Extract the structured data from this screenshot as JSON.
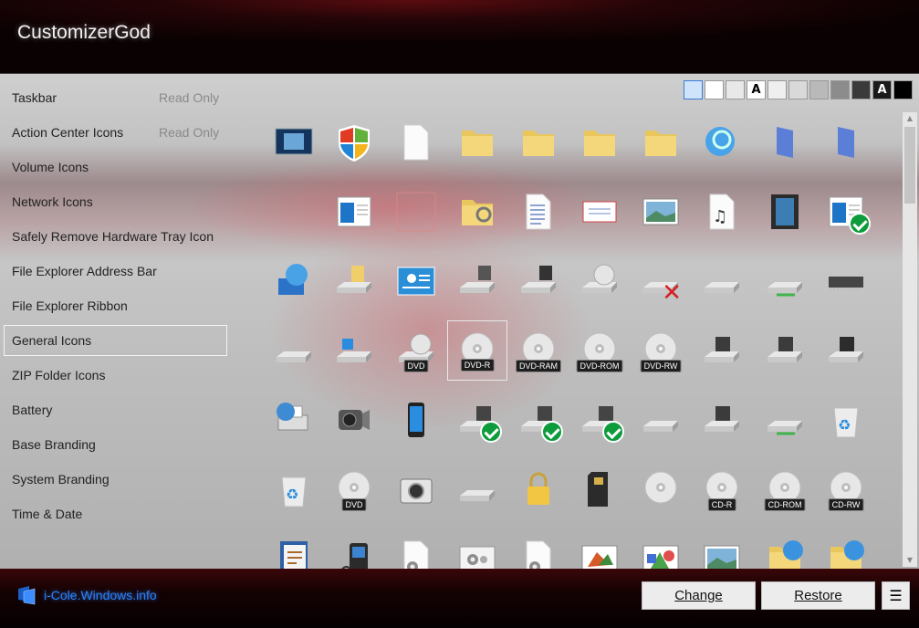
{
  "app": {
    "title": "CustomizerGod"
  },
  "sidebar": {
    "items": [
      {
        "label": "Taskbar",
        "badge": "Read Only"
      },
      {
        "label": "Action Center Icons",
        "badge": "Read Only"
      },
      {
        "label": "Volume Icons"
      },
      {
        "label": "Network Icons"
      },
      {
        "label": "Safely Remove Hardware Tray Icon"
      },
      {
        "label": "File Explorer Address Bar"
      },
      {
        "label": "File Explorer Ribbon"
      },
      {
        "label": "General Icons",
        "selected": true
      },
      {
        "label": "ZIP Folder Icons"
      },
      {
        "label": "Battery"
      },
      {
        "label": "Base Branding"
      },
      {
        "label": "System Branding"
      },
      {
        "label": "Time & Date"
      }
    ]
  },
  "swatches": [
    {
      "color": "#cfe3fa",
      "text": ""
    },
    {
      "color": "#ffffff",
      "text": ""
    },
    {
      "color": "#e8e8e8",
      "text": ""
    },
    {
      "color": "#ffffff",
      "text": "A",
      "text_color": "#000000"
    },
    {
      "color": "#efefef",
      "text": ""
    },
    {
      "color": "#d9d9d9",
      "text": ""
    },
    {
      "color": "#b9b9b9",
      "text": ""
    },
    {
      "color": "#8c8c8c",
      "text": ""
    },
    {
      "color": "#3a3a3a",
      "text": ""
    },
    {
      "color": "#1a1a1a",
      "text": "A",
      "text_color": "#ffffff"
    },
    {
      "color": "#000000",
      "text": ""
    }
  ],
  "icon_grid": [
    [
      "monitor-windows-icon",
      "shield-icon",
      "blank-document-icon",
      "folder-icon",
      "folder-icon",
      "folder-icon",
      "folder-narrow-icon",
      "",
      "globe-search-icon",
      "library-icon",
      "library-narrow-icon"
    ],
    [
      "",
      "window-app-icon",
      "blank-square-icon",
      "folder-search-icon",
      "text-document-icon",
      "envelope-document-icon",
      "image-document-icon",
      "music-document-icon",
      "video-document-icon",
      "window-check-icon"
    ],
    [
      "network-globe-icon",
      "drive-folder-icon",
      "control-panel-icon",
      "floppy-drive-icon",
      "floppy-drive-dark-icon",
      "cd-drive-icon",
      "drive-error-icon",
      "drive-icon",
      "network-drive-icon",
      "memory-chip-icon"
    ],
    [
      "drive-flat-icon",
      "windows-drive-icon",
      "dvd-drive-icon",
      "dvd-r-disc-icon",
      "dvd-ram-disc-icon",
      "dvd-rom-disc-icon",
      "dvd-rw-disc-icon",
      "removable-drive-icon",
      "card-drive-icon",
      "usb-drive-icon"
    ],
    [
      "printer-network-icon",
      "camcorder-icon",
      "phone-icon",
      "drive-check-icon",
      "drive-check-icon",
      "drive-check-icon",
      "drive-icon",
      "removable-drive-icon",
      "network-drive-icon",
      "recycle-bin-full-icon"
    ],
    [
      "recycle-bin-empty-icon",
      "dvd-disc-icon",
      "camera-icon",
      "drive-shortcut-icon",
      "padlock-icon",
      "sd-card-icon",
      "disc-icon",
      "cd-r-disc-icon",
      "cd-rom-disc-icon",
      "cd-rw-disc-icon"
    ],
    [
      "contacts-icon",
      "media-player-icon",
      "settings-document-icon",
      "settings-window-icon",
      "settings-file-icon",
      "paint-picture-icon",
      "shapes-picture-icon",
      "landscape-picture-icon",
      "network-folder-icon",
      "network-folder-icon"
    ]
  ],
  "disc_labels": {
    "dvd-drive-icon": "DVD",
    "dvd-r-disc-icon": "DVD-R",
    "dvd-ram-disc-icon": "DVD-RAM",
    "dvd-rom-disc-icon": "DVD-ROM",
    "dvd-rw-disc-icon": "DVD-RW",
    "dvd-disc-icon": "DVD",
    "cd-r-disc-icon": "CD-R",
    "cd-rom-disc-icon": "CD-ROM",
    "cd-rw-disc-icon": "CD-RW"
  },
  "footer": {
    "brand_text": "i-Cole.Windows.info",
    "change_label": "Change",
    "restore_label": "Restore",
    "menu_glyph": "☰"
  },
  "colors": {
    "accent": "#2a82ff",
    "check": "#0e9b3c",
    "error": "#d51f24"
  }
}
